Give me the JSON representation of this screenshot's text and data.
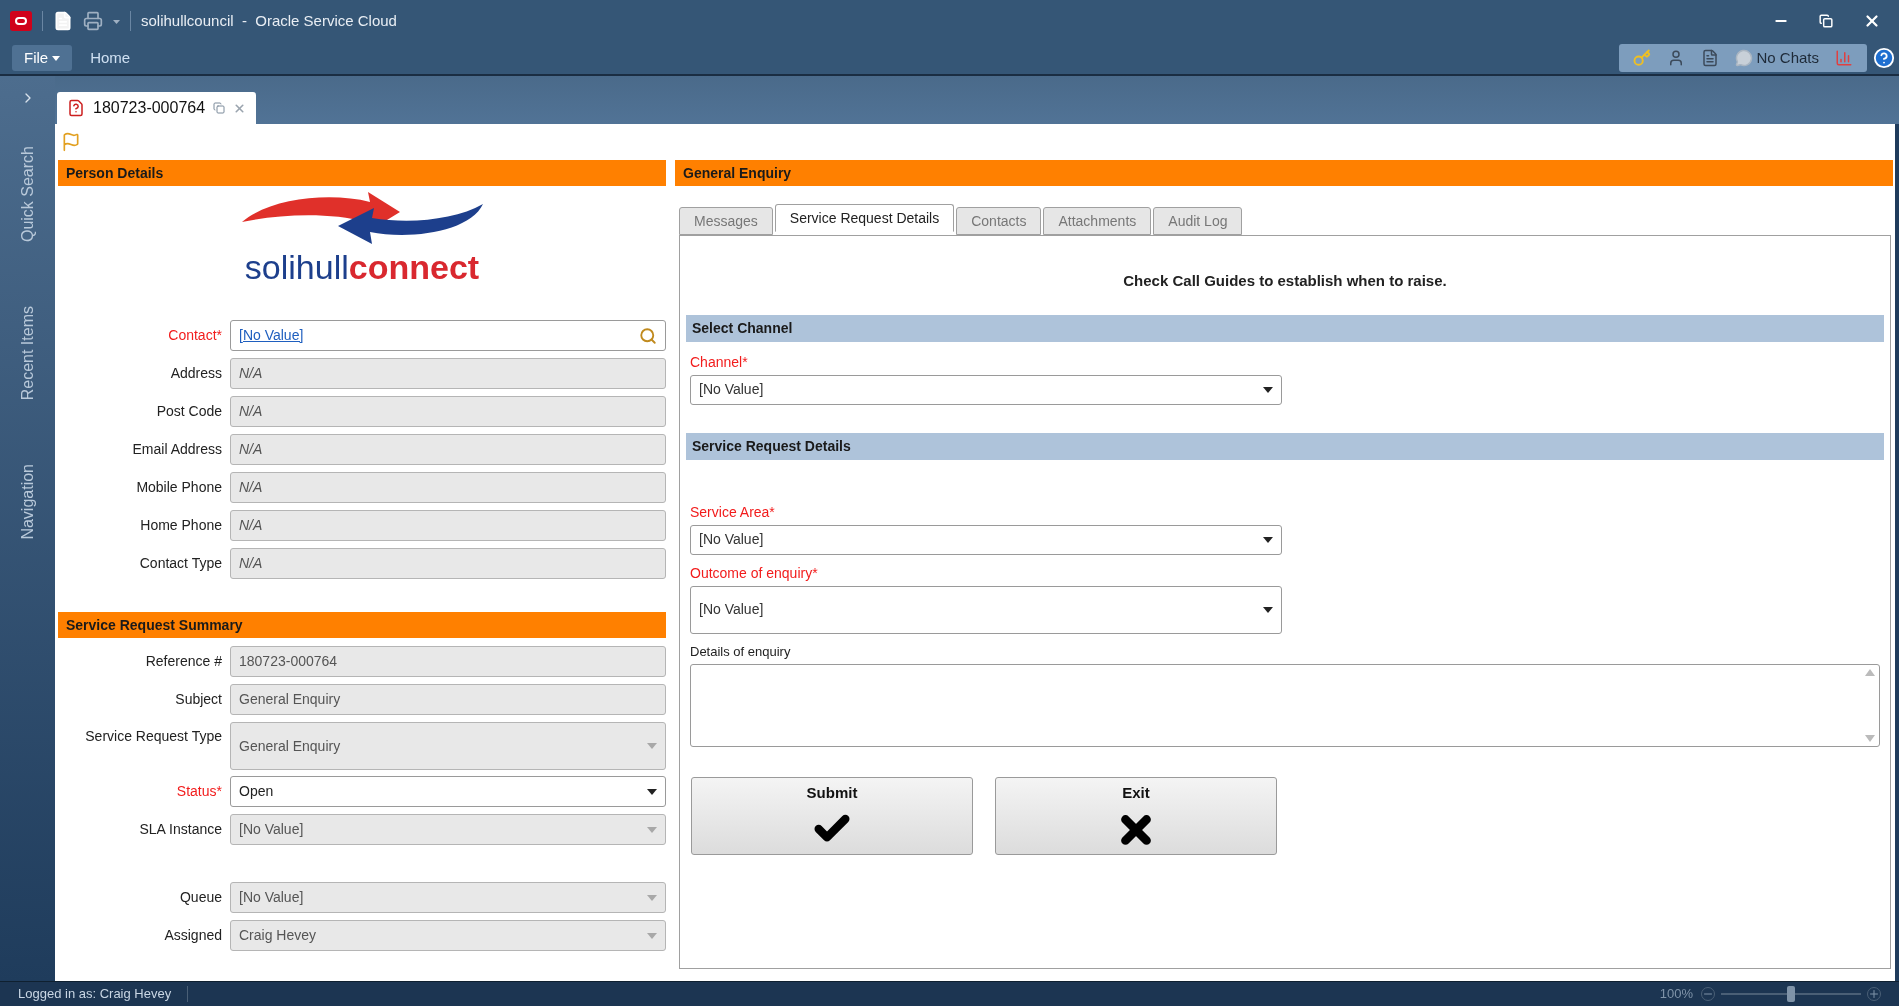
{
  "window": {
    "title": "solihullcouncil  -  Oracle Service Cloud"
  },
  "menu": [
    {
      "label": "File",
      "kind": "dropdown",
      "selected": true
    },
    {
      "label": "Home",
      "kind": "tab",
      "selected": false
    }
  ],
  "status_pill": {
    "chats": "No Chats"
  },
  "sidebar": {
    "items": [
      {
        "label": "Quick Search"
      },
      {
        "label": "Recent Items"
      },
      {
        "label": "Navigation"
      }
    ]
  },
  "document_tab": {
    "label": "180723-000764"
  },
  "person_details": {
    "title": "Person Details",
    "logo": {
      "text_1": "solihull",
      "text_2": "connect"
    },
    "fields": [
      {
        "label": "Contact*",
        "required": true,
        "kind": "link",
        "value": "[No Value]",
        "disabled": false
      },
      {
        "label": "Address",
        "required": false,
        "kind": "text",
        "value": "N/A",
        "disabled": true
      },
      {
        "label": "Post Code",
        "required": false,
        "kind": "text",
        "value": "N/A",
        "disabled": true
      },
      {
        "label": "Email Address",
        "required": false,
        "kind": "text",
        "value": "N/A",
        "disabled": true
      },
      {
        "label": "Mobile Phone",
        "required": false,
        "kind": "text",
        "value": "N/A",
        "disabled": true
      },
      {
        "label": "Home Phone",
        "required": false,
        "kind": "text",
        "value": "N/A",
        "disabled": true
      },
      {
        "label": "Contact Type",
        "required": false,
        "kind": "text",
        "value": "N/A",
        "disabled": true
      }
    ]
  },
  "summary": {
    "title": "Service Request Summary",
    "fields": [
      {
        "label": "Reference #",
        "required": false,
        "kind": "text",
        "value": "180723-000764",
        "disabled": true
      },
      {
        "label": "Subject",
        "required": false,
        "kind": "text",
        "value": "General Enquiry",
        "disabled": true
      },
      {
        "label": "Service Request Type",
        "required": false,
        "kind": "tallselect",
        "value": "General Enquiry",
        "disabled": true
      },
      {
        "label": "Status*",
        "required": true,
        "kind": "select",
        "value": "Open",
        "disabled": false
      },
      {
        "label": "SLA Instance",
        "required": false,
        "kind": "select",
        "value": "[No Value]",
        "disabled": true
      },
      {
        "label": "Queue",
        "required": false,
        "kind": "spacedselect",
        "value": "[No Value]",
        "disabled": true
      },
      {
        "label": "Assigned",
        "required": false,
        "kind": "select",
        "value": "Craig Hevey",
        "disabled": true
      }
    ]
  },
  "general_enquiry": {
    "title": "General Enquiry",
    "tabs": [
      {
        "label": "Messages",
        "selected": false
      },
      {
        "label": "Service Request Details",
        "selected": true
      },
      {
        "label": "Contacts",
        "selected": false
      },
      {
        "label": "Attachments",
        "selected": false
      },
      {
        "label": "Audit Log",
        "selected": false
      }
    ],
    "notice": "Check Call Guides to establish when to raise.",
    "sections": [
      {
        "title": "Select Channel",
        "fields": [
          {
            "label": "Channel*",
            "required": true,
            "kind": "select",
            "value": "[No Value]"
          }
        ]
      },
      {
        "title": "Service Request Details",
        "fields": [
          {
            "label": "Service Area*",
            "required": true,
            "kind": "select",
            "value": "[No Value]"
          },
          {
            "label": "Outcome of enquiry*",
            "required": true,
            "kind": "tallselect",
            "value": "[No Value]"
          },
          {
            "label": "Details of enquiry",
            "required": false,
            "kind": "textarea"
          }
        ]
      }
    ],
    "buttons": [
      {
        "label": "Submit",
        "kind": "submit"
      },
      {
        "label": "Exit",
        "kind": "exit"
      }
    ]
  },
  "status_bar": {
    "user": "Logged in as: Craig Hevey",
    "zoom": "100%",
    "level": 0.5
  }
}
